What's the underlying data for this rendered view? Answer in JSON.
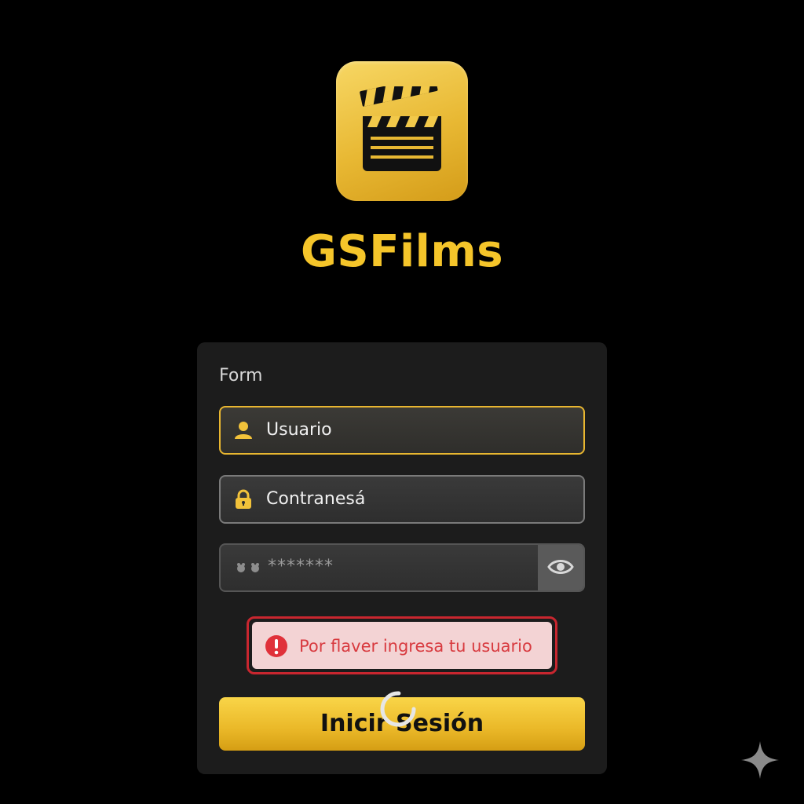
{
  "app": {
    "title": "GSFilms",
    "logo_icon": "clapperboard-icon"
  },
  "form": {
    "heading": "Form",
    "username": {
      "label": "Usuario",
      "icon": "user-icon"
    },
    "password_label": {
      "label": "Contranesá",
      "icon": "lock-icon"
    },
    "password_input": {
      "masked_value": "*******",
      "toggle_icon": "eye-icon"
    },
    "error": {
      "message": "Por flaver ingresa tu usuario",
      "icon": "alert-icon"
    },
    "submit": {
      "label": "Inicir Sesión"
    }
  },
  "colors": {
    "brand": "#f5c52a",
    "error": "#d83a3f",
    "background": "#000000",
    "card": "#1c1c1c"
  }
}
